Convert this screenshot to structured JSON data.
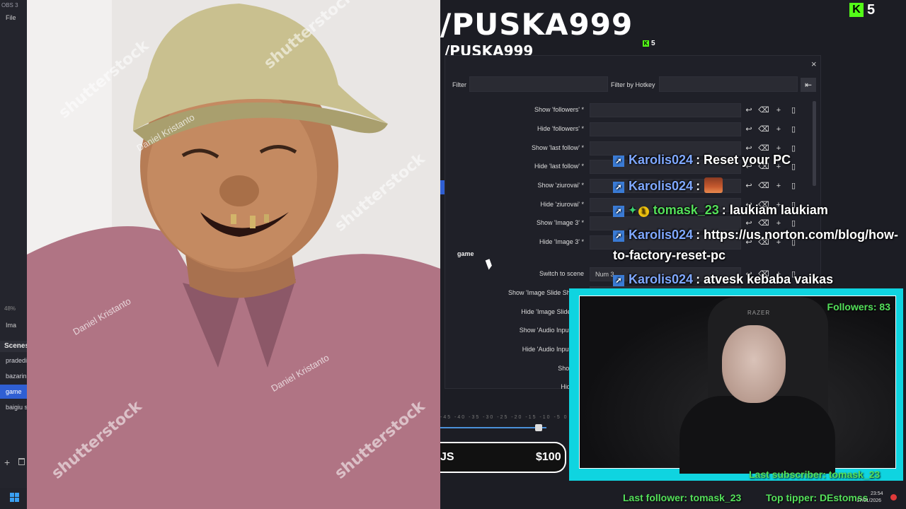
{
  "obs": {
    "title": "OBS 3",
    "menu_file": "File",
    "percent": "48%",
    "image_label": "Ima",
    "scenes_header": "Scenes",
    "scenes": [
      {
        "label": "pradedi",
        "active": false
      },
      {
        "label": "bazarin",
        "active": false
      },
      {
        "label": "game",
        "active": true
      },
      {
        "label": "baigiu s",
        "active": false
      }
    ]
  },
  "stock_photo": {
    "watermarks": [
      "shutterstock",
      "Daniel Kristanto"
    ]
  },
  "channel": {
    "name": "/PUSKA999",
    "kick_badge": "K",
    "kick_count": "5"
  },
  "hotkeys_dialog": {
    "close": "×",
    "filter_label": "Filter",
    "filter_value": "",
    "hotkey_filter_label": "Filter by Hotkey",
    "clear_icon": "⇤",
    "group_label": "game",
    "rows": [
      {
        "label": "Show 'followers' *",
        "value": ""
      },
      {
        "label": "Hide 'followers' *",
        "value": ""
      },
      {
        "label": "Show 'last follow' *",
        "value": ""
      },
      {
        "label": "Hide 'last follow' *",
        "value": ""
      },
      {
        "label": "Show 'ziurovai' *",
        "value": ""
      },
      {
        "label": "Hide 'ziurovai' *",
        "value": ""
      },
      {
        "label": "Show 'Image 3' *",
        "value": ""
      },
      {
        "label": "Hide 'Image 3' *",
        "value": ""
      },
      {
        "label": "Switch to scene",
        "value": "Num 3"
      },
      {
        "label": "Show 'Image Slide Show' *",
        "value": ""
      },
      {
        "label": "Hide 'Image Slide Sho",
        "value": ""
      },
      {
        "label": "Show 'Audio Input Cap",
        "value": ""
      },
      {
        "label": "Hide 'Audio Input Cap",
        "value": ""
      },
      {
        "label": "Show 'Im",
        "value": ""
      },
      {
        "label": "Hide 'Im",
        "value": ""
      }
    ]
  },
  "chat": [
    {
      "user": "Karolis024",
      "text": ": Reset your PC",
      "badges": [
        "kick"
      ],
      "emote": false
    },
    {
      "user": "Karolis024",
      "text": ":",
      "badges": [
        "kick"
      ],
      "emote": true
    },
    {
      "user": "tomask_23",
      "text": ": laukiam laukiam",
      "badges": [
        "kick",
        "gem",
        "coin"
      ],
      "emote": false
    },
    {
      "user": "Karolis024",
      "text": ": https://us.norton.com/blog/how-",
      "badges": [
        "kick"
      ],
      "emote": false
    },
    {
      "user": "",
      "text": "to-factory-reset-pc",
      "badges": [],
      "emote": false
    },
    {
      "user": "Karolis024",
      "text": ": atvesk kebaba vaikas",
      "badges": [
        "kick"
      ],
      "emote": false
    }
  ],
  "webcam": {
    "followers": "Followers: 83",
    "chair_brand": "RAZER",
    "last_subscriber": "Last subscriber: tomask_23"
  },
  "bottom": {
    "audio_scale": "-45 -40 -35 -30 -25 -20 -15 -10 -5 0",
    "ticker_left": "JS",
    "ticker_right": "$100",
    "last_follower": "Last follower: tomask_23",
    "top_tipper": "Top tipper: DEstomss"
  },
  "taskbar": {
    "time": "23:54",
    "date": "17/01/2026"
  },
  "colors": {
    "kick_green": "#53fc18",
    "overlay_green": "#54e05a",
    "cyan_frame": "#0fd4e0",
    "obs_blue": "#2f5fd3",
    "chat_user_blue": "#7fa8ff"
  }
}
